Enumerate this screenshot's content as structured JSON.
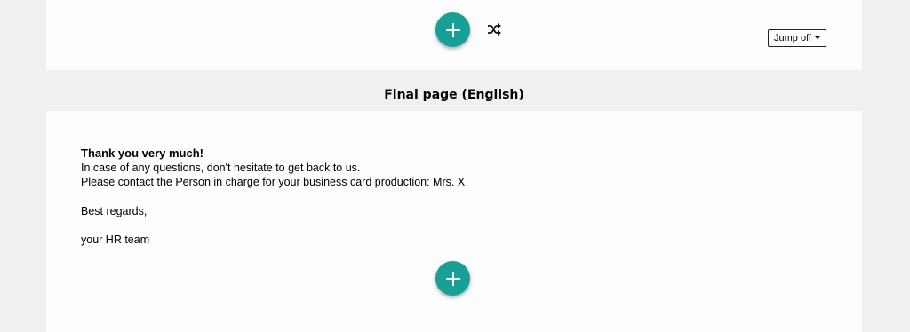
{
  "top_panel": {
    "add_button_label": "+",
    "shuffle_icon": "shuffle-icon",
    "jump_button_label": "Jump off"
  },
  "section": {
    "title": "Final page (English)"
  },
  "final_page": {
    "heading": "Thank you very much!",
    "line1": "In case of any questions, don't hesitate to get back to us.",
    "line2": "Please contact the Person in charge for your business card production: Mrs. X",
    "line3": "Best regards,",
    "line4": "your HR team"
  },
  "colors": {
    "accent": "#17a097",
    "background": "#f0f0f0",
    "panel": "#fdfdfd"
  }
}
